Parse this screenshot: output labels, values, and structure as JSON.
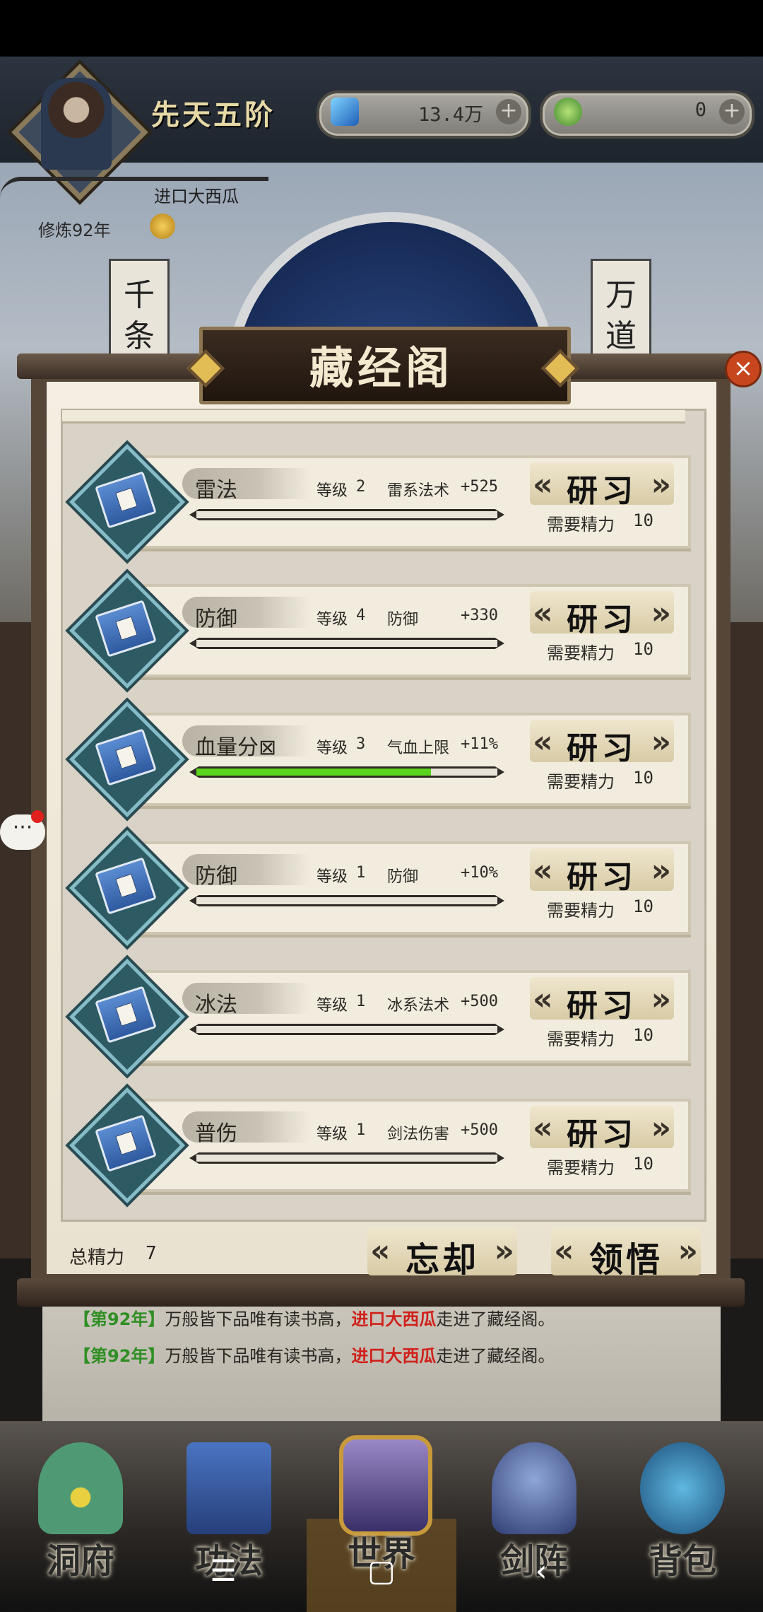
{
  "header": {
    "rank": "先天五阶",
    "currencies": [
      {
        "icon": "blue-crystal-icon",
        "value": "13.4万"
      },
      {
        "icon": "jade-coin-icon",
        "value": "0"
      }
    ],
    "player_name": "进口大西瓜",
    "cultivation_years": "修炼92年"
  },
  "scene": {
    "left_couplet": "千条",
    "right_couplet": "万道"
  },
  "dialog": {
    "title": "藏经阁",
    "close_icon": "close-icon",
    "skills": [
      {
        "name": "雷法",
        "level_label": "等级",
        "level": "2",
        "effect_label": "雷系法术",
        "effect_value": "+525",
        "progress": 0,
        "button": "研习",
        "cost_label": "需要精力",
        "cost": "10"
      },
      {
        "name": "防御",
        "level_label": "等级",
        "level": "4",
        "effect_label": "防御",
        "effect_value": "+330",
        "progress": 0,
        "button": "研习",
        "cost_label": "需要精力",
        "cost": "10"
      },
      {
        "name": "血量分⊠",
        "level_label": "等级",
        "level": "3",
        "effect_label": "气血上限",
        "effect_value": "+11%",
        "progress": 0.78,
        "button": "研习",
        "cost_label": "需要精力",
        "cost": "10"
      },
      {
        "name": "防御",
        "level_label": "等级",
        "level": "1",
        "effect_label": "防御",
        "effect_value": "+10%",
        "progress": 0,
        "button": "研习",
        "cost_label": "需要精力",
        "cost": "10"
      },
      {
        "name": "冰法",
        "level_label": "等级",
        "level": "1",
        "effect_label": "冰系法术",
        "effect_value": "+500",
        "progress": 0,
        "button": "研习",
        "cost_label": "需要精力",
        "cost": "10"
      },
      {
        "name": "普伤",
        "level_label": "等级",
        "level": "1",
        "effect_label": "剑法伤害",
        "effect_value": "+500",
        "progress": 0,
        "button": "研习",
        "cost_label": "需要精力",
        "cost": "10"
      }
    ],
    "total_label": "总精力",
    "total_value": "7",
    "forget_button": "忘却",
    "comprehend_button": "领悟"
  },
  "log": [
    {
      "year": "【第92年】",
      "text1": "万般皆下品唯有读书高，",
      "name": "进口大西瓜",
      "text2": "走进了藏经阁。"
    },
    {
      "year": "【第92年】",
      "text1": "万般皆下品唯有读书高，",
      "name": "进口大西瓜",
      "text2": "走进了藏经阁。"
    }
  ],
  "nav": [
    {
      "label": "洞府",
      "icon": "cave-dwelling-icon"
    },
    {
      "label": "功法",
      "icon": "skill-book-icon"
    },
    {
      "label": "世界",
      "icon": "world-icon"
    },
    {
      "label": "剑阵",
      "icon": "sword-array-icon"
    },
    {
      "label": "背包",
      "icon": "backpack-icon"
    }
  ],
  "system": {
    "menu": "☰",
    "home": "▢",
    "back": "‹"
  },
  "colors": {
    "progress_fill": "#5ad41c",
    "log_year": "#2f8f24",
    "log_name": "#d0201a",
    "close": "#c8461e"
  }
}
